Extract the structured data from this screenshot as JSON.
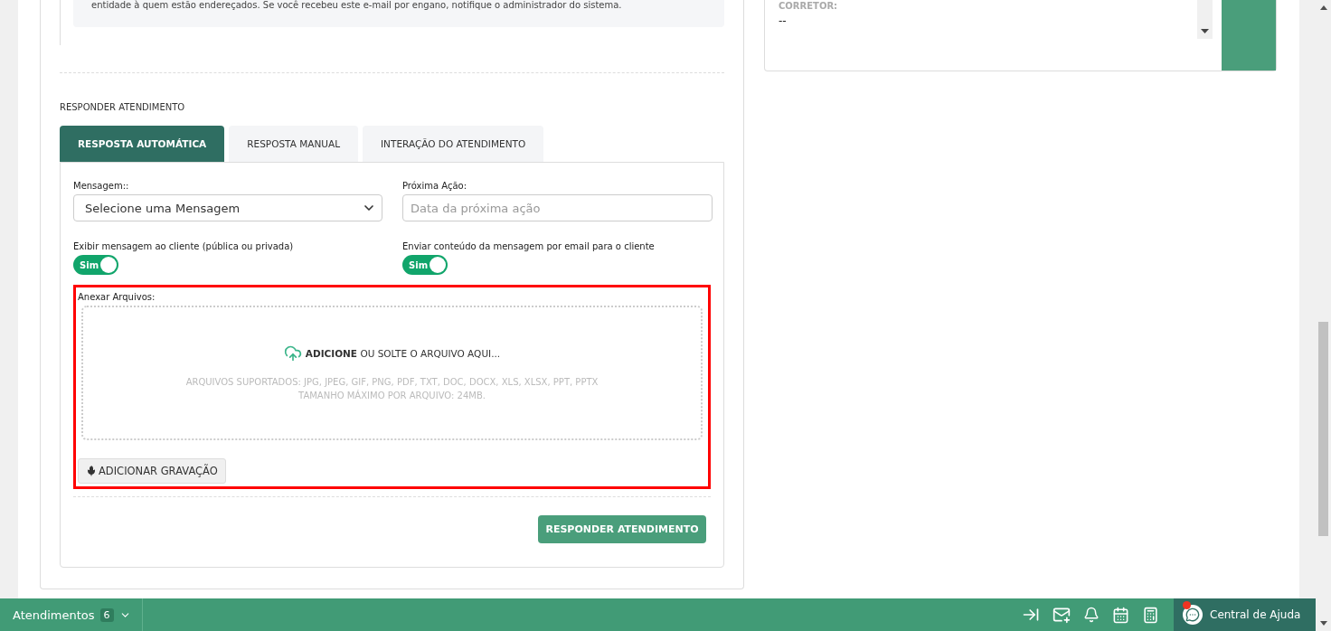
{
  "email_notice": {
    "text": "entidade à quem estão endereçados. Se você recebeu este e-mail por engano, notifique o administrador do sistema."
  },
  "reply_section": {
    "title": "RESPONDER ATENDIMENTO",
    "tabs": [
      {
        "label": "RESPOSTA AUTOMÁTICA",
        "selected": true
      },
      {
        "label": "RESPOSTA MANUAL",
        "selected": false
      },
      {
        "label": "INTERAÇÃO DO ATENDIMENTO",
        "selected": false
      }
    ]
  },
  "form": {
    "message": {
      "label": "Mensagem::",
      "value": "Selecione uma Mensagem"
    },
    "next_action": {
      "label": "Próxima Ação:",
      "placeholder": "Data da próxima ação"
    },
    "toggles": [
      {
        "label": "Exibir mensagem ao cliente (pública ou privada)",
        "text": "Sim",
        "on": true
      },
      {
        "label": "Enviar conteúdo da mensagem por email para o cliente",
        "text": "Sim",
        "on": true
      }
    ],
    "attachments": {
      "label": "Anexar Arquivos:",
      "drop_text": "**ADICIONE** OU SOLTE O ARQUIVO AQUI...",
      "supported": "ARQUIVOS SUPORTADOS: JPG, JPEG, GIF, PNG, PDF, TXT, DOC, DOCX, XLS, XLSX, PPT, PPTX",
      "max_size": "TAMANHO MÁXIMO POR ARQUIVO: 24MB."
    },
    "record_button": "ADICIONAR GRAVAÇÃO",
    "submit_button": "RESPONDER ATENDIMENTO"
  },
  "side_panel": {
    "field_label": "CORRETOR:",
    "field_value": "--"
  },
  "bottom_bar": {
    "label": "Atendimentos",
    "count": "6",
    "help": "Central de Ajuda",
    "help_alert": true
  }
}
